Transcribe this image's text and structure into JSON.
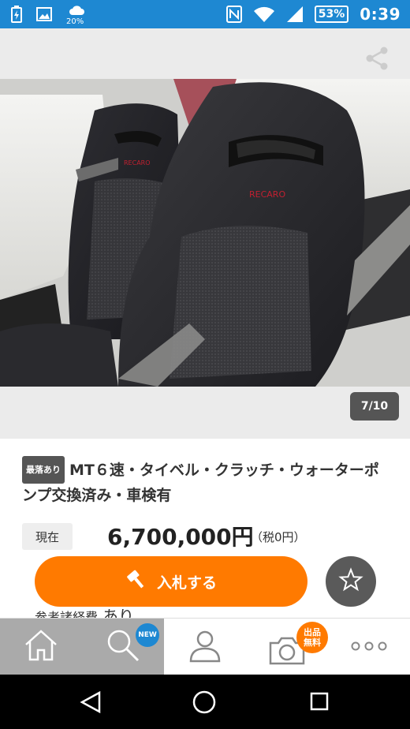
{
  "status_bar": {
    "weather_percent": "20%",
    "battery": "53%",
    "time": "0:39",
    "icons": [
      "charging-battery-icon",
      "image-icon",
      "cloud-icon",
      "nfc-icon",
      "wifi-icon",
      "signal-icon"
    ]
  },
  "photo": {
    "counter": "7/10",
    "brand_text": "RECARO"
  },
  "listing": {
    "tag": "最落あり",
    "title": "MT６速・タイベル・クラッチ・ウォーターポンプ交換済み・車検有",
    "price_label": "現在",
    "price": "6,700,000円",
    "tax": "（税0円）",
    "bid_label": "入札する",
    "fees_label": "参考諸経費",
    "fees_value": "あり"
  },
  "tabbar": {
    "new_badge": "NEW",
    "sell_badge_line1": "出品",
    "sell_badge_line2": "無料",
    "active_tab": "search"
  },
  "colors": {
    "status_bar": "#1e88d2",
    "accent_orange": "#ff7a00",
    "badge_blue": "#1e88d2"
  }
}
